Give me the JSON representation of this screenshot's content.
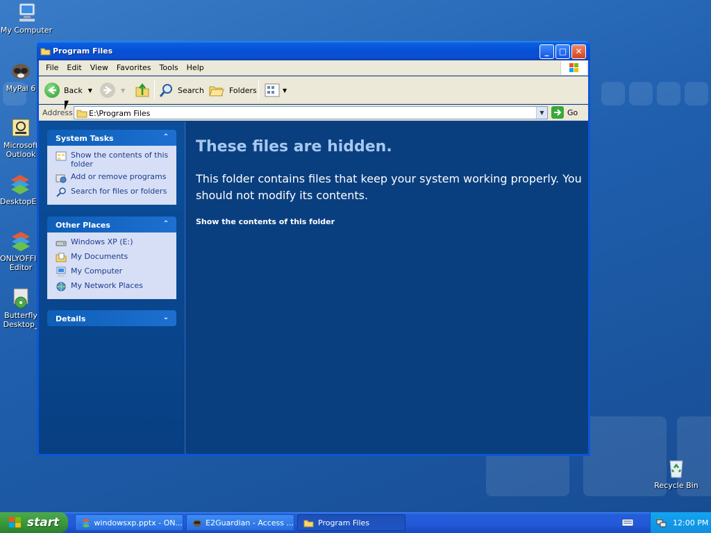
{
  "desktop": {
    "icons": [
      {
        "label": "My Computer"
      },
      {
        "label": "MyPal 6"
      },
      {
        "label": "Microsoft Outlook"
      },
      {
        "label": "DesktopEditors"
      },
      {
        "label": "ONLYOFFICE Editor"
      },
      {
        "label": "Butterfly Desktop_"
      },
      {
        "label": "Recycle Bin"
      }
    ]
  },
  "window": {
    "title": "Program Files",
    "menu": [
      "File",
      "Edit",
      "View",
      "Favorites",
      "Tools",
      "Help"
    ],
    "toolbar": {
      "back": "Back",
      "search": "Search",
      "folders": "Folders"
    },
    "address": {
      "label": "Address",
      "value": "E:\\Program Files",
      "go": "Go"
    },
    "system_tasks": {
      "title": "System Tasks",
      "items": [
        "Show the contents of this folder",
        "Add or remove programs",
        "Search for files or folders"
      ]
    },
    "other_places": {
      "title": "Other Places",
      "items": [
        "Windows XP (E:)",
        "My Documents",
        "My Computer",
        "My Network Places"
      ]
    },
    "details": {
      "title": "Details"
    },
    "main": {
      "heading": "These files are hidden.",
      "message": "This folder contains files that keep your system working properly. You should not modify its contents.",
      "link": "Show the contents of this folder"
    }
  },
  "taskbar": {
    "start": "start",
    "buttons": [
      {
        "label": "windowsxp.pptx - ON..."
      },
      {
        "label": "E2Guardian - Access ..."
      },
      {
        "label": "Program Files"
      }
    ],
    "clock": "12:00 PM"
  },
  "colors": {
    "window_border": "#0b56d6",
    "task_pane_bg": "#0b4f9c",
    "main_bg": "#0a3f7f",
    "heading": "#a6c8f0",
    "start_green": "#3a9a3a"
  }
}
